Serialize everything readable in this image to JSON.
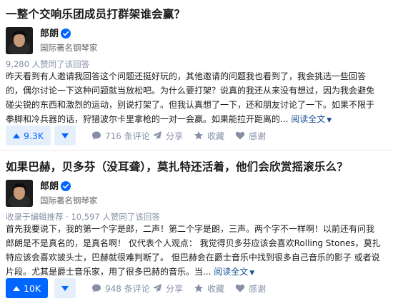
{
  "colors": {
    "accent": "#0066ff",
    "link": "#175199",
    "muted": "#8590a6",
    "vote_bg": "#e5effb"
  },
  "answers": [
    {
      "question_title": "一整个交响乐团成员打群架谁会赢？",
      "author": {
        "name": "郎朗",
        "bio": "国际著名钢琴家",
        "verified_icon": "verified-badge-icon"
      },
      "meta": "9,280 人赞同了该回答",
      "body_lines": [
        "昨天看到有人邀请我回答这个问题还挺好玩的，其他邀请的问题我也看到了，我会挑选一些回答",
        "的，偶尔讨论一下这种问题就当放松吧。为什么要打架？说真的我还从来没有想过，因为我会避免",
        "碰尖锐的东西和激烈的运动，别说打架了。但我认真想了一下，还和朋友讨论了一下。如果不限于",
        "拳脚和冷兵器的话，狩猎波尔卡里拿枪的一对一会赢。如果能拉开距离的..."
      ],
      "read_more": "阅读全文",
      "actions": {
        "vote": "9.3K",
        "comments": "716 条评论",
        "share": "分享",
        "favorite": "收藏",
        "thanks": "感谢"
      }
    },
    {
      "question_title": "如果巴赫，贝多芬（没耳聋），莫扎特还活着，他们会欣赏摇滚乐么？",
      "author": {
        "name": "郎朗",
        "bio": "国际著名钢琴家",
        "verified_icon": "verified-badge-icon"
      },
      "meta": "收录于编辑推荐 · 10,597 人赞同了该回答",
      "body_lines": [
        "首先我要说下，我的第一个字是郎，二声！第二个字是朗，三声。两个字不一样啊！以前还有问我",
        "郎朗是不是真名的，是真名啊！ 仅代表个人观点： 我觉得贝多芬应该会喜欢Rolling Stones，莫扎",
        "特应该会喜欢披头士，巴赫就很难判断了。 但巴赫会在爵士音乐中找到很多自己音乐的影子 或者说",
        "片段。尤其是爵士音乐家，用了很多巴赫的音乐。当..."
      ],
      "read_more": "阅读全文",
      "actions": {
        "vote": "10K",
        "comments": "948 条评论",
        "share": "分享",
        "favorite": "收藏",
        "thanks": "感谢"
      }
    }
  ]
}
